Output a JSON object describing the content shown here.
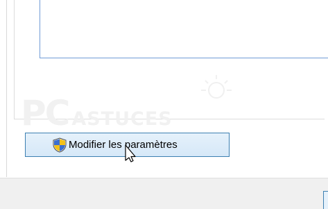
{
  "dialog": {
    "modify_button_label": "Modifier les paramètres"
  },
  "watermark": {
    "brand_main": "PC",
    "brand_sub": "ASTUCES"
  },
  "icons": {
    "uac_shield": "uac-shield-icon",
    "cursor": "mouse-pointer-icon",
    "watermark_logo": "sun-logo-icon"
  },
  "colors": {
    "list_border": "#6f9bd6",
    "button_border": "#3c7fb1",
    "button_fill": "#e5f1fb",
    "footer_bg": "#f0f0f0"
  }
}
